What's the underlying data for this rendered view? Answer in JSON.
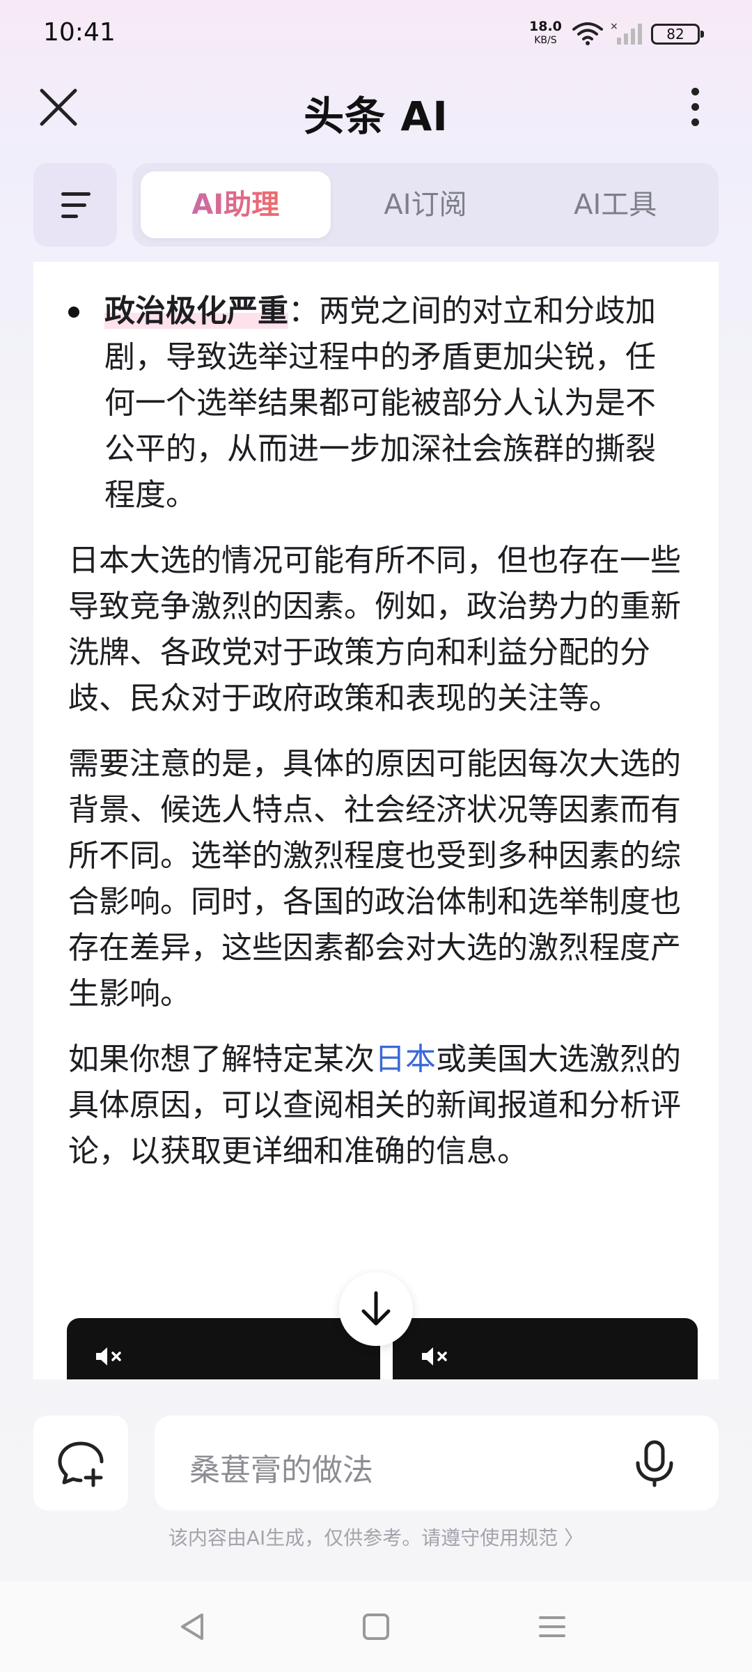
{
  "status_bar": {
    "time": "10:41",
    "net_speed_value": "18.0",
    "net_speed_unit": "KB/S",
    "battery": "82"
  },
  "header": {
    "title": "头条 AI",
    "icons": [
      "close-icon",
      "more-vertical-icon"
    ]
  },
  "tabs": [
    {
      "label": "AI助理",
      "active": true
    },
    {
      "label": "AI订阅",
      "active": false
    },
    {
      "label": "AI工具",
      "active": false
    }
  ],
  "content": {
    "bullet": {
      "heading": "政治极化严重",
      "text": "：两党之间的对立和分歧加剧，导致选举过程中的矛盾更加尖锐，任何一个选举结果都可能被部分人认为是不公平的，从而进一步加深社会族群的撕裂程度。"
    },
    "paragraph_1": "日本大选的情况可能有所不同，但也存在一些导致竞争激烈的因素。例如，政治势力的重新洗牌、各政党对于政策方向和利益分配的分歧、民众对于政府政策和表现的关注等。",
    "paragraph_2": "需要注意的是，具体的原因可能因每次大选的背景、候选人特点、社会经济状况等因素而有所不同。选举的激烈程度也受到多种因素的综合影响。同时，各国的政治体制和选举制度也存在差异，这些因素都会对大选的激烈程度产生影响。",
    "paragraph_3": {
      "before_link": "如果你想了解特定某次",
      "link": "日本",
      "after_link": "或美国大选激烈的具体原因，可以查阅相关的新闻报道和分析评论，以获取更详细和准确的信息。"
    }
  },
  "input": {
    "placeholder": "桑葚膏的做法"
  },
  "disclaimer": "该内容由AI生成，仅供参考。请遵守使用规范 〉",
  "colors": {
    "accent_pink": "#e05a86",
    "link_blue": "#3a68d8"
  }
}
